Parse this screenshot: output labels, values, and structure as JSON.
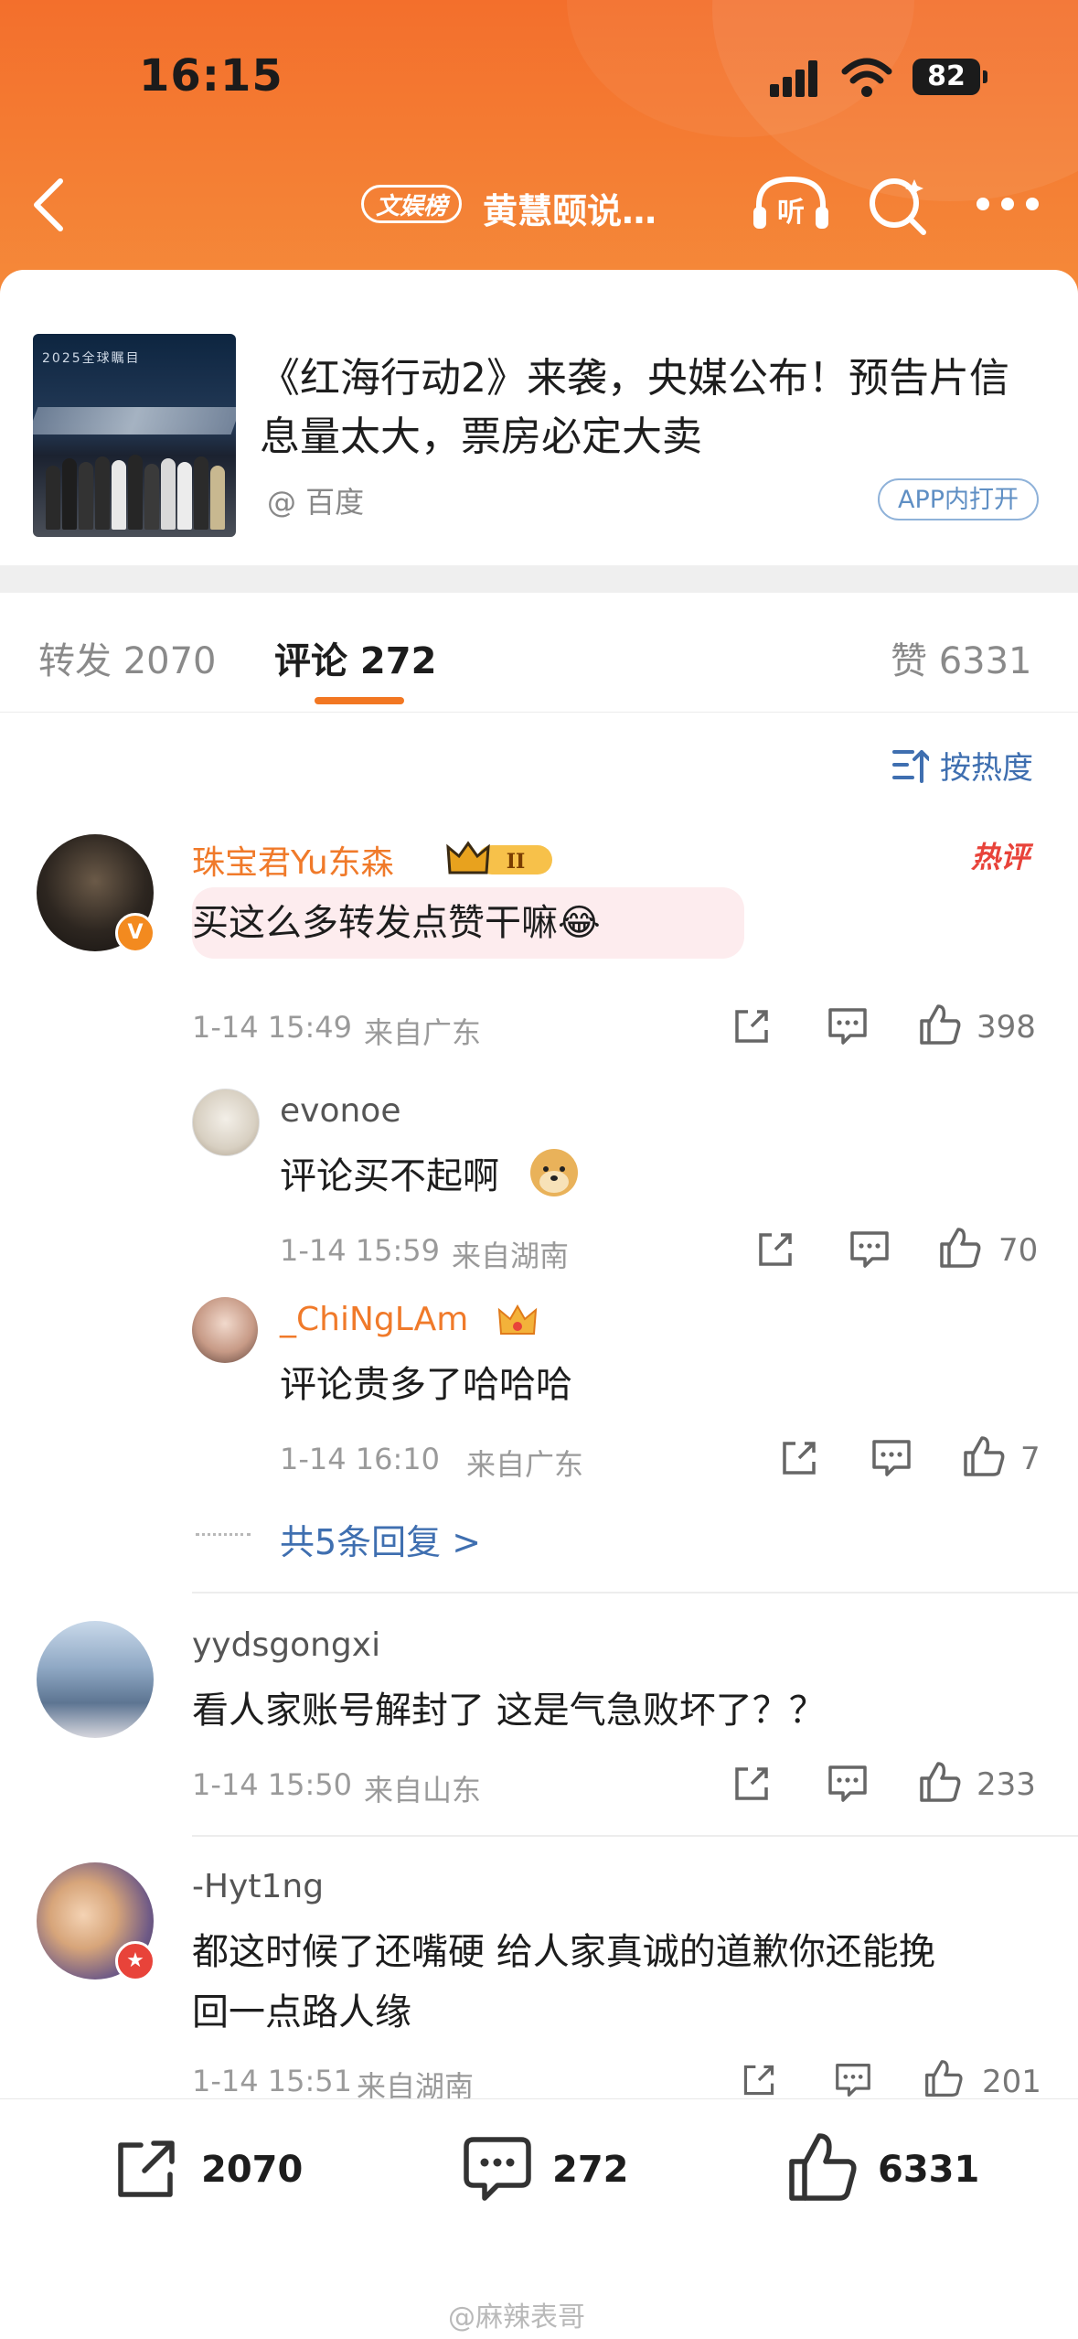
{
  "status_bar": {
    "time": "16:15",
    "battery": "82"
  },
  "nav": {
    "source_badge": "文娱榜",
    "title": "黄慧颐说…",
    "listen_label": "听"
  },
  "article": {
    "title": "《红海行动2》来袭，央媒公布！预告片信息量太大，票房必定大卖",
    "source": "@ 百度",
    "open_app": "APP内打开",
    "thumb_text": "2025全球瞩目"
  },
  "tabs": {
    "repost": "转发 2070",
    "comment": "评论 272",
    "likes": "赞 6331"
  },
  "sort_label": "按热度",
  "hot_label": "热评",
  "comments": [
    {
      "user": "珠宝君Yu东森",
      "text": "买这么多转发点赞干嘛😂",
      "time": "1-14 15:49",
      "location": "来自广东",
      "likes": "398",
      "vip_level": "II"
    },
    {
      "user": "evonoe",
      "text": "评论买不起啊",
      "time": "1-14 15:59",
      "location": "来自湖南",
      "likes": "70"
    },
    {
      "user": "_ChiNgLAm",
      "text": "评论贵多了哈哈哈",
      "time": "1-14 16:10",
      "location": "来自广东",
      "likes": "7"
    },
    {
      "user": "yydsgongxi",
      "text": "看人家账号解封了 这是气急败坏了？？",
      "time": "1-14 15:50",
      "location": "来自山东",
      "likes": "233"
    },
    {
      "user": "-Hyt1ng",
      "text_line1": "都这时候了还嘴硬 给人家真诚的道歉你还能挽",
      "text_line2": "回一点路人缘",
      "time": "1-14 15:51",
      "location": "来自湖南",
      "likes": "201"
    }
  ],
  "more_replies": "共5条回复 >",
  "bottom_bar": {
    "repost": "2070",
    "comment": "272",
    "like": "6331"
  },
  "watermark": "@麻辣表哥",
  "colors": {
    "accent": "#f27722",
    "link": "#3f6fb0",
    "header": "#f36f2c"
  }
}
